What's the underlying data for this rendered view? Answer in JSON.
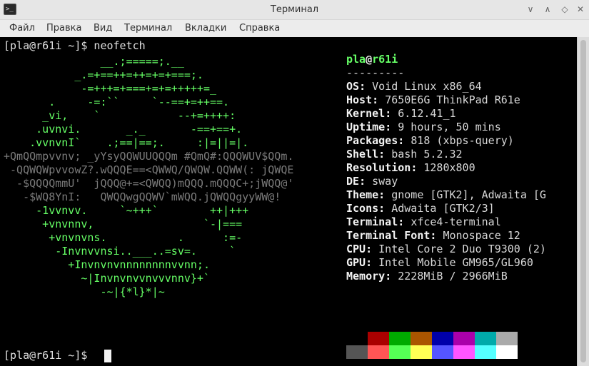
{
  "window": {
    "title": "Терминал",
    "icon_glyph": ">_"
  },
  "menu": [
    "Файл",
    "Правка",
    "Вид",
    "Терминал",
    "Вкладки",
    "Справка"
  ],
  "terminal": {
    "prompt_command": "[pla@r61i ~]$ neofetch",
    "prompt_idle": "[pla@r61i ~]$ ",
    "art": [
      "               __.;=====;.__",
      "           _.=+==++=++=+=+===;.",
      "            -=+++=+===+=+=+++++=_",
      "       .     -=:``     `--==+=++==.",
      "      _vi,    `            --+=++++:",
      "     .uvnvi.       _._       -==+==+.",
      "    .vvnvnI`    .;==|==;.     :|=||=|.",
      "+QmQQmpvvnv; _yYsyQQWUUQQQm #QmQ#:QQQWUV$QQm.",
      " -QQWQWpvvowZ?.wQQQE==<QWWQ/QWQW.QQWW(: jQWQE",
      "  -$QQQQmmU'  jQQQ@+=<QWQQ)mQQQ.mQQQC+;jWQQ@'",
      "   -$WQ8YnI:   QWQQwgQQWV`mWQQ.jQWQQgyyWW@!",
      "     -1vvnvv.     `~+++`        ++|+++",
      "      +vnvnnv,                 `-|===",
      "       +vnvnvns.           .      :=-",
      "        -Invnvvnsi..___..=sv=.     `",
      "          +Invnvnvnnnnnnnnvvnn;.",
      "            ~|Invnvnvvnvvvnnv}+`",
      "               -~|{*l}*|~"
    ],
    "info": {
      "user": "pla",
      "at": "@",
      "host": "r61i",
      "separator": "---------",
      "rows": [
        {
          "key": "OS",
          "value": "Void Linux x86_64"
        },
        {
          "key": "Host",
          "value": "7650E6G ThinkPad R61e"
        },
        {
          "key": "Kernel",
          "value": "6.12.41_1"
        },
        {
          "key": "Uptime",
          "value": "9 hours, 50 mins"
        },
        {
          "key": "Packages",
          "value": "818 (xbps-query)"
        },
        {
          "key": "Shell",
          "value": "bash 5.2.32"
        },
        {
          "key": "Resolution",
          "value": "1280x800"
        },
        {
          "key": "DE",
          "value": "sway"
        },
        {
          "key": "Theme",
          "value": "gnome [GTK2], Adwaita [G"
        },
        {
          "key": "Icons",
          "value": "Adwaita [GTK2/3]"
        },
        {
          "key": "Terminal",
          "value": "xfce4-terminal"
        },
        {
          "key": "Terminal Font",
          "value": "Monospace 12"
        },
        {
          "key": "CPU",
          "value": "Intel Core 2 Duo T9300 (2)"
        },
        {
          "key": "GPU",
          "value": "Intel Mobile GM965/GL960"
        },
        {
          "key": "Memory",
          "value": "2228MiB / 2966MiB"
        }
      ]
    },
    "palette_normal": [
      "#000000",
      "#aa0000",
      "#00aa00",
      "#aa5500",
      "#0000aa",
      "#aa00aa",
      "#00aaaa",
      "#aaaaaa"
    ],
    "palette_bright": [
      "#555555",
      "#ff5555",
      "#55ff55",
      "#ffff55",
      "#5555ff",
      "#ff55ff",
      "#55ffff",
      "#ffffff"
    ]
  }
}
